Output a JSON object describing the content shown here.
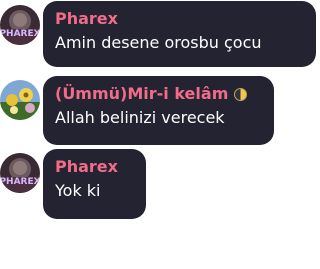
{
  "messages": [
    {
      "sender": "Pharex",
      "text": "Amin desene orosbu çocu",
      "avatar_text": "PHAREX",
      "avatar_icon": "pharex-avatar-icon"
    },
    {
      "sender": "(Ümmü)Mir-i kelâm",
      "text": "Allah belinizi verecek",
      "badge_icon": "crescent-moon-icon",
      "avatar_icon": "flower-avatar-icon"
    },
    {
      "sender": "Pharex",
      "text": "Yok ki",
      "avatar_text": "PHAREX",
      "avatar_icon": "pharex-avatar-icon"
    }
  ],
  "colors": {
    "bubble": "#232332",
    "sender_name": "#f06c89",
    "message_text": "#ffffff"
  }
}
